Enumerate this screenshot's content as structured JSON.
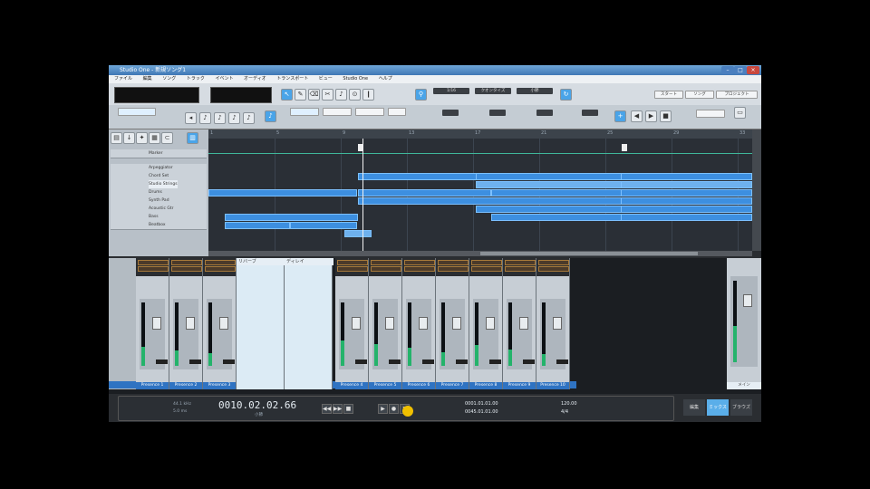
{
  "window": {
    "title": "Studio One - 新規ソング1"
  },
  "menu": [
    "ファイル",
    "編集",
    "ソング",
    "トラック",
    "イベント",
    "オーディオ",
    "トランスポート",
    "ビュー",
    "Studio One",
    "ヘルプ"
  ],
  "toolbar": {
    "tools": [
      "↖",
      "✎",
      "⌫",
      "✂",
      "♪",
      "⊙",
      "❙"
    ],
    "quantize_label": "1/16",
    "snap_label": "クオンタイズ",
    "timebase_label": "小節",
    "start_label": "スタート",
    "song_label": "ソング",
    "project_label": "プロジェクト"
  },
  "ruler": [
    "1",
    "5",
    "9",
    "13",
    "17",
    "21",
    "25",
    "29",
    "33"
  ],
  "tracks": [
    {
      "name": "Marker"
    },
    {
      "name": "Arpeggiator"
    },
    {
      "name": "Chord Set"
    },
    {
      "name": "Studio Strings"
    },
    {
      "name": "Drums"
    },
    {
      "name": "Synth Pad"
    },
    {
      "name": "Acoustic Gtr"
    },
    {
      "name": "Bass"
    },
    {
      "name": "Beatbox"
    }
  ],
  "mixer": {
    "bus1": "リバーブ",
    "bus2": "ディレイ",
    "channels": [
      "Presence 1",
      "Presence 2",
      "Presence 3",
      "Presence 4",
      "Presence 5",
      "Presence 6",
      "Presence 7",
      "Presence 8",
      "Presence 9",
      "Presence 10"
    ],
    "main": "メイン"
  },
  "transport": {
    "sample_rate": "44.1 kHz",
    "latency": "5.0 ms",
    "time": "0010.02.02.66",
    "unit": "小節",
    "loop_start": "0001.01.01.00",
    "loop_end": "0045.01.01.00",
    "tempo": "120.00",
    "signature": "4/4"
  },
  "tabs": [
    "編集",
    "ミックス",
    "ブラウズ"
  ]
}
